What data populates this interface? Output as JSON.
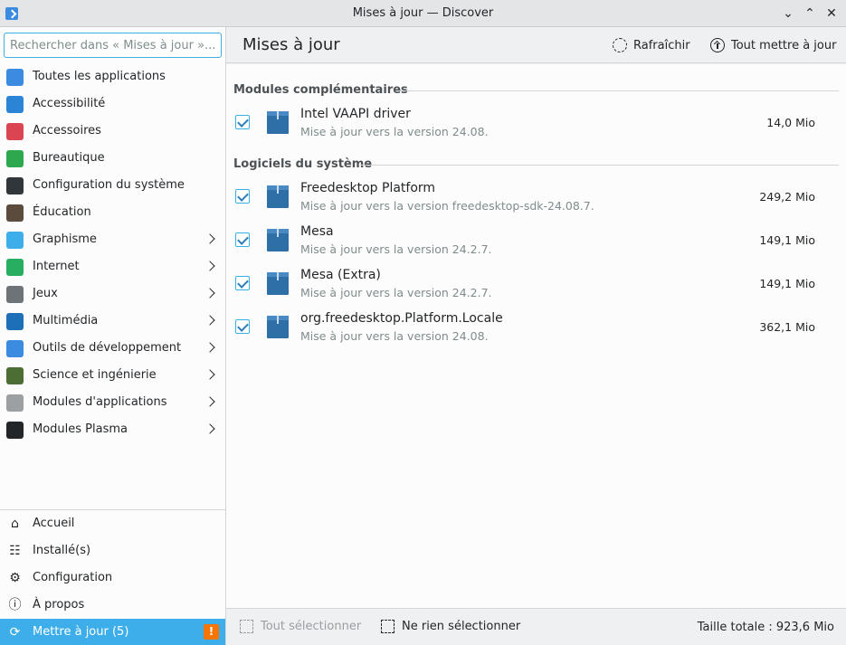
{
  "window": {
    "title": "Mises à jour — Discover"
  },
  "search": {
    "placeholder": "Rechercher dans « Mises à jour »..."
  },
  "categories": [
    {
      "label": "Toutes les applications",
      "icon": "grid-icon",
      "color": "#3b8be0",
      "sub": false
    },
    {
      "label": "Accessibilité",
      "icon": "accessibility-icon",
      "color": "#2c84d6",
      "sub": false
    },
    {
      "label": "Accessoires",
      "icon": "toolbox-icon",
      "color": "#da4453",
      "sub": false
    },
    {
      "label": "Bureautique",
      "icon": "office-icon",
      "color": "#2ea84f",
      "sub": false
    },
    {
      "label": "Configuration du système",
      "icon": "system-settings-icon",
      "color": "#31363b",
      "sub": false
    },
    {
      "label": "Éducation",
      "icon": "blackboard-icon",
      "color": "#5a4b3c",
      "sub": false
    },
    {
      "label": "Graphisme",
      "icon": "graphics-icon",
      "color": "#3daee9",
      "sub": true
    },
    {
      "label": "Internet",
      "icon": "globe-icon",
      "color": "#27ae60",
      "sub": true
    },
    {
      "label": "Jeux",
      "icon": "gamepad-icon",
      "color": "#6e7378",
      "sub": true
    },
    {
      "label": "Multimédia",
      "icon": "monitor-icon",
      "color": "#1d6fb8",
      "sub": true
    },
    {
      "label": "Outils de développement",
      "icon": "hammer-icon",
      "color": "#3b8be0",
      "sub": true
    },
    {
      "label": "Science et ingénierie",
      "icon": "flask-icon",
      "color": "#4c6d34",
      "sub": true
    },
    {
      "label": "Modules d'applications",
      "icon": "plugin-icon",
      "color": "#9da0a3",
      "sub": true
    },
    {
      "label": "Modules Plasma",
      "icon": "plasma-icon",
      "color": "#232629",
      "sub": true
    }
  ],
  "bottom_nav": [
    {
      "label": "Accueil",
      "icon": "home-icon",
      "glyph": "⌂"
    },
    {
      "label": "Installé(s)",
      "icon": "installed-list-icon",
      "glyph": "☷"
    },
    {
      "label": "Configuration",
      "icon": "settings-sliders-icon",
      "glyph": "⚙"
    },
    {
      "label": "À propos",
      "icon": "info-icon",
      "glyph": "ⓘ"
    },
    {
      "label": "Mettre à jour (5)",
      "icon": "update-icon",
      "glyph": "⟳",
      "active": true,
      "badge": "!"
    }
  ],
  "header": {
    "title": "Mises à jour",
    "refresh_label": "Rafraîchir",
    "update_all_label": "Tout mettre à jour"
  },
  "sections": [
    {
      "title": "Modules complémentaires",
      "items": [
        {
          "name": "Intel VAAPI driver",
          "desc": "Mise à jour vers la version 24.08.",
          "size": "14,0 Mio",
          "checked": true
        }
      ]
    },
    {
      "title": "Logiciels du système",
      "items": [
        {
          "name": "Freedesktop Platform",
          "desc": "Mise à jour vers la version freedesktop-sdk-24.08.7.",
          "size": "249,2 Mio",
          "checked": true
        },
        {
          "name": "Mesa",
          "desc": "Mise à jour vers la version 24.2.7.",
          "size": "149,1 Mio",
          "checked": true
        },
        {
          "name": "Mesa (Extra)",
          "desc": "Mise à jour vers la version 24.2.7.",
          "size": "149,1 Mio",
          "checked": true
        },
        {
          "name": "org.freedesktop.Platform.Locale",
          "desc": "Mise à jour vers la version 24.08.",
          "size": "362,1 Mio",
          "checked": true
        }
      ]
    }
  ],
  "footer": {
    "select_all_label": "Tout sélectionner",
    "select_none_label": "Ne rien sélectionner",
    "total_label": "Taille totale : 923,6 Mio"
  },
  "colors": {
    "accent": "#3daee9",
    "badge": "#f67400"
  }
}
